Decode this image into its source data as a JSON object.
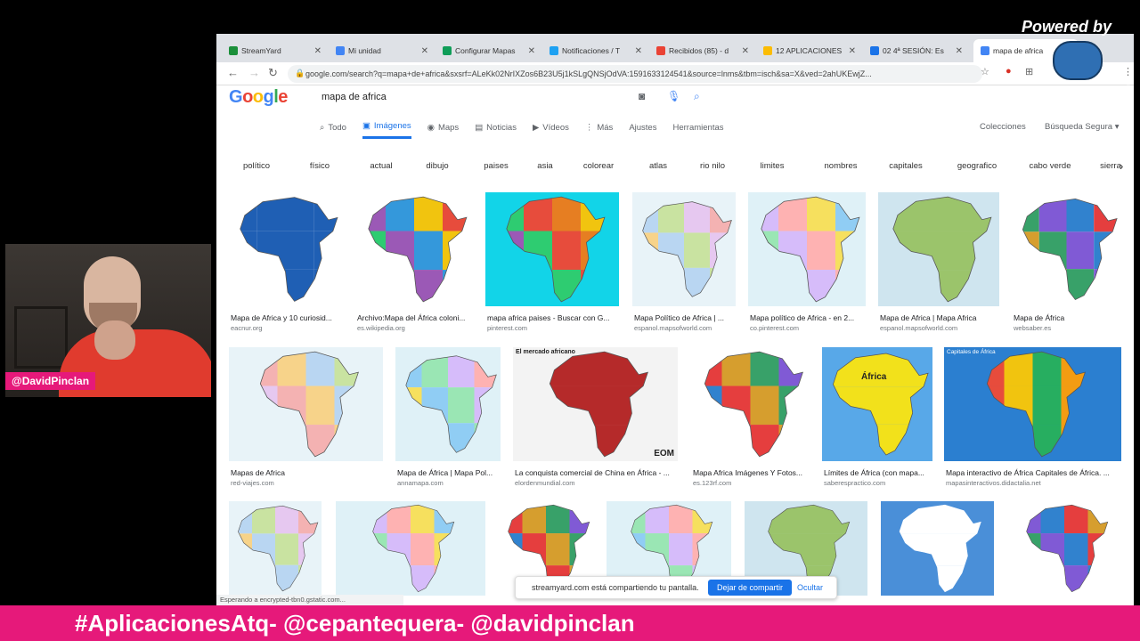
{
  "overlay": {
    "powered_by": "Powered by",
    "streamyard_logo": "StreamYard",
    "webcam_name": "@DavidPinclan",
    "banner": "#AplicacionesAtq- @cepantequera- @davidpinclan"
  },
  "browser": {
    "tabs": [
      {
        "label": "StreamYard",
        "color": "#1b8f3a"
      },
      {
        "label": "Mi unidad",
        "color": "#4285f4"
      },
      {
        "label": "Configurar Mapas",
        "color": "#0f9d58"
      },
      {
        "label": "Notificaciones / T",
        "color": "#1da1f2"
      },
      {
        "label": "Recibidos (85) - d",
        "color": "#ea4335"
      },
      {
        "label": "12 APLICACIONES",
        "color": "#fbbc04"
      },
      {
        "label": "02 4ª SESIÓN: Es",
        "color": "#1a73e8"
      },
      {
        "label": "mapa de africa",
        "color": "#4285f4"
      }
    ],
    "url": "google.com/search?q=mapa+de+africa&sxsrf=ALeKk02NrIXZos6B23U5j1kSLgQNSjOdVA:1591633124541&source=lnms&tbm=isch&sa=X&ved=2ahUKEwjZ...",
    "status": "Esperando a encrypted-tbn0.gstatic.com..."
  },
  "google": {
    "logo": "Google",
    "query": "mapa de africa",
    "menu": [
      {
        "label": "Todo",
        "icon": "search-icon"
      },
      {
        "label": "Imágenes",
        "icon": "image-icon",
        "active": true
      },
      {
        "label": "Maps",
        "icon": "pin-icon"
      },
      {
        "label": "Noticias",
        "icon": "news-icon"
      },
      {
        "label": "Vídeos",
        "icon": "video-icon"
      },
      {
        "label": "Más",
        "icon": "more-icon"
      },
      {
        "label": "Ajustes",
        "icon": ""
      },
      {
        "label": "Herramientas",
        "icon": ""
      }
    ],
    "collections": "Colecciones",
    "safesearch": "Búsqueda Segura ▾",
    "chips": [
      "político",
      "físico",
      "actual",
      "dibujo",
      "paises",
      "asia",
      "colorear",
      "atlas",
      "rio nilo",
      "limites",
      "nombres",
      "capitales",
      "geografico",
      "cabo verde",
      "sierra"
    ]
  },
  "results": [
    {
      "caption": "Mapa de Africa y 10 curiosid...",
      "source": "eacnur.org",
      "style": "blue"
    },
    {
      "caption": "Archivo:Mapa del África coloni...",
      "source": "es.wikipedia.org",
      "style": "colonial"
    },
    {
      "caption": "mapa africa paises - Buscar con G...",
      "source": "pinterest.com",
      "style": "cyan"
    },
    {
      "caption": "Mapa Político de Africa | ...",
      "source": "espanol.mapsofworld.com",
      "style": "pastel"
    },
    {
      "caption": "Mapa político de Africa - en 2...",
      "source": "co.pinterest.com",
      "style": "political"
    },
    {
      "caption": "Mapa de Africa | Mapa Africa",
      "source": "espanol.mapsofworld.com",
      "style": "physical"
    },
    {
      "caption": "Mapa de África",
      "source": "websaber.es",
      "style": "vivid"
    },
    {
      "caption": "Mapas de Africa",
      "source": "red-viajes.com",
      "style": "pastel"
    },
    {
      "caption": "Mapa de África | Mapa Pol...",
      "source": "annamapa.com",
      "style": "political"
    },
    {
      "caption": "La conquista comercial de China en África - ...",
      "source": "elordenmundial.com",
      "style": "red"
    },
    {
      "caption": "Mapa Africa Imágenes Y Fotos...",
      "source": "es.123rf.com",
      "style": "vivid"
    },
    {
      "caption": "Límites de África (con mapa...",
      "source": "saberespractico.com",
      "style": "yellow"
    },
    {
      "caption": "Mapa interactivo de África Capitales de África. ...",
      "source": "mapasinteractivos.didactalia.net",
      "style": "interactive"
    },
    {
      "caption": "",
      "source": "",
      "style": "pastel"
    },
    {
      "caption": "",
      "source": "",
      "style": "political"
    },
    {
      "caption": "",
      "source": "",
      "style": "vivid"
    },
    {
      "caption": "",
      "source": "",
      "style": "political"
    },
    {
      "caption": "",
      "source": "",
      "style": "physical"
    },
    {
      "caption": "",
      "source": "",
      "style": "outline"
    },
    {
      "caption": "",
      "source": "",
      "style": "vivid"
    }
  ],
  "map_labels": {
    "yellow_title": "África",
    "red_header": "El mercado africano",
    "red_logo": "EOM",
    "interactive_header": "Capitales de África"
  },
  "share_bar": {
    "text": "streamyard.com está compartiendo tu pantalla.",
    "stop": "Dejar de compartir",
    "hide": "Ocultar"
  }
}
